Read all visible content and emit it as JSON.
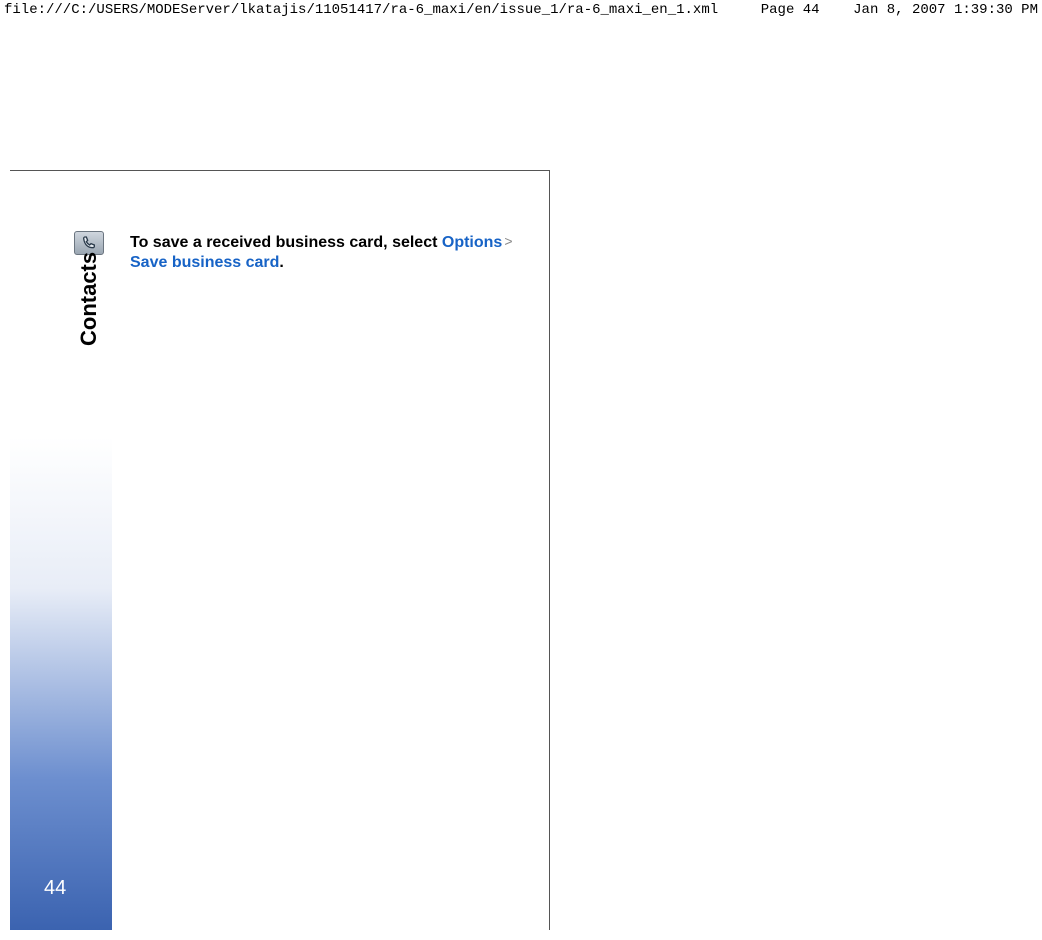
{
  "header": {
    "path": "file:///C:/USERS/MODEServer/lkatajis/11051417/ra-6_maxi/en/issue_1/ra-6_maxi_en_1.xml",
    "page_label": "Page 44",
    "timestamp": "Jan 8, 2007 1:39:30 PM"
  },
  "side": {
    "section": "Contacts",
    "page_number": "44",
    "icon": "phone-icon"
  },
  "body": {
    "prefix": "To save a received business card, select ",
    "options": "Options",
    "sep": ">",
    "save": "Save business card",
    "suffix": "."
  }
}
